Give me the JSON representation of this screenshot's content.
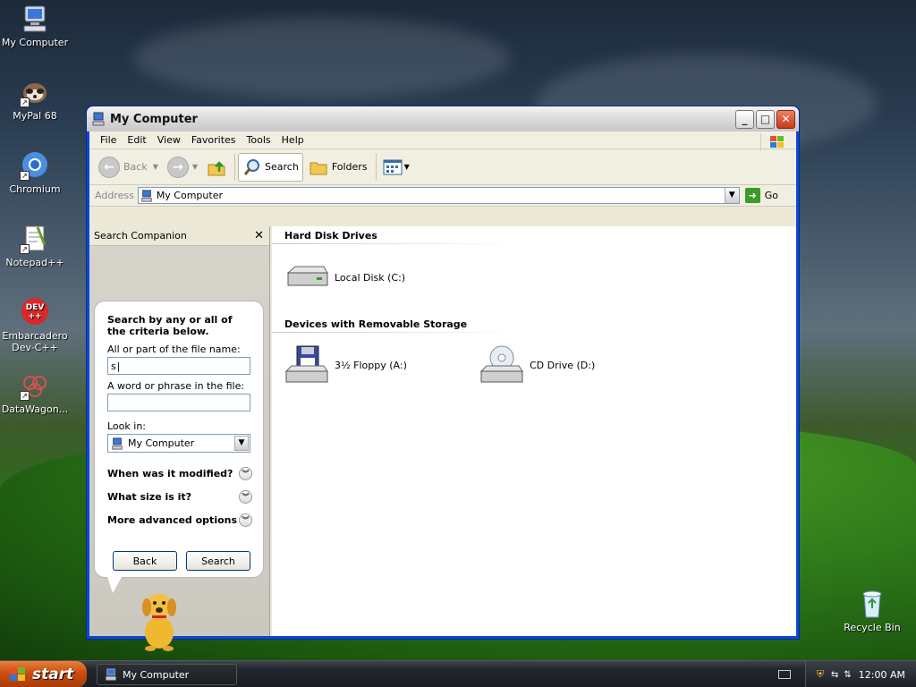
{
  "desktop": {
    "icons": [
      {
        "label": "My Computer"
      },
      {
        "label": "MyPal 68"
      },
      {
        "label": "Chromium"
      },
      {
        "label": "Notepad++"
      },
      {
        "label": "Embarcadero Dev-C++"
      },
      {
        "label": "DataWagon..."
      },
      {
        "label": "Recycle Bin"
      }
    ]
  },
  "window": {
    "title": "My Computer",
    "menu": [
      "File",
      "Edit",
      "View",
      "Favorites",
      "Tools",
      "Help"
    ],
    "toolbar": {
      "back_label": "Back",
      "search_label": "Search",
      "folders_label": "Folders"
    },
    "address": {
      "label": "Address",
      "value": "My Computer",
      "go_label": "Go"
    }
  },
  "search_companion": {
    "header": "Search Companion",
    "intro": "Search by any or all of the criteria below.",
    "filename_label": "All or part of the file name:",
    "filename_value": "s",
    "phrase_label": "A word or phrase in the file:",
    "phrase_value": "",
    "lookin_label": "Look in:",
    "lookin_value": "My Computer",
    "options": [
      "When was it modified?",
      "What size is it?",
      "More advanced options"
    ],
    "back_button": "Back",
    "search_button": "Search"
  },
  "content": {
    "groups": [
      {
        "heading": "Hard Disk Drives",
        "items": [
          "Local Disk (C:)"
        ]
      },
      {
        "heading": "Devices with Removable Storage",
        "items": [
          "3½ Floppy (A:)",
          "CD Drive (D:)"
        ]
      }
    ]
  },
  "taskbar": {
    "start_label": "start",
    "task_label": "My Computer",
    "clock": "12:00 AM"
  },
  "colors": {
    "title_bar": "#dcdcdc",
    "start_button": "#c94d10",
    "window_border": "#0a49d6"
  }
}
